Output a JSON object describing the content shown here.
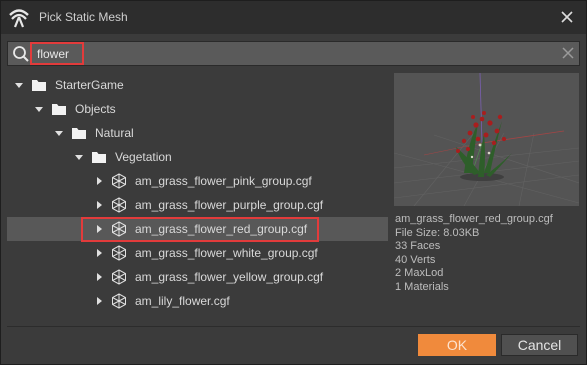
{
  "window": {
    "title": "Pick Static Mesh"
  },
  "search": {
    "value": "flower",
    "placeholder": ""
  },
  "tree": {
    "folders": [
      {
        "label": "StarterGame",
        "expanded": true
      },
      {
        "label": "Objects",
        "expanded": true
      },
      {
        "label": "Natural",
        "expanded": true
      },
      {
        "label": "Vegetation",
        "expanded": true
      }
    ],
    "files": [
      {
        "label": "am_grass_flower_pink_group.cgf"
      },
      {
        "label": "am_grass_flower_purple_group.cgf"
      },
      {
        "label": "am_grass_flower_red_group.cgf",
        "selected": true
      },
      {
        "label": "am_grass_flower_white_group.cgf"
      },
      {
        "label": "am_grass_flower_yellow_group.cgf"
      },
      {
        "label": "am_lily_flower.cgf"
      }
    ]
  },
  "details": {
    "file_name": "am_grass_flower_red_group.cgf",
    "file_size": "File Size: 8.03KB",
    "faces": "33 Faces",
    "verts": "40 Verts",
    "max_lod": "2 MaxLod",
    "materials": "1 Materials"
  },
  "footer": {
    "ok_label": "OK",
    "cancel_label": "Cancel"
  },
  "colors": {
    "accent": "#f08a3c",
    "highlight": "#e23b3b",
    "selection": "#585858",
    "background": "#3b3b3b"
  }
}
